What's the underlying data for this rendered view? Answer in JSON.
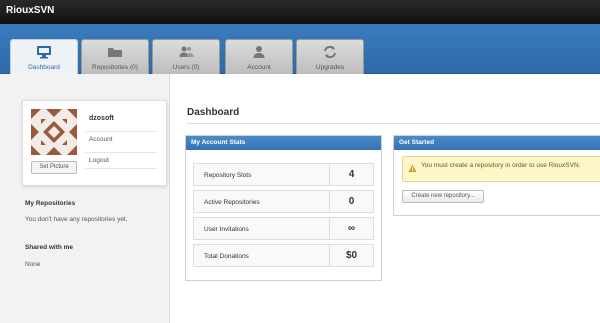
{
  "app": {
    "title": "RiouxSVN"
  },
  "tabs": [
    {
      "label": "Dashboard",
      "icon": "monitor-icon",
      "active": true
    },
    {
      "label": "Repositories (0)",
      "icon": "folder-icon",
      "active": false
    },
    {
      "label": "Users (0)",
      "icon": "users-icon",
      "active": false
    },
    {
      "label": "Account",
      "icon": "user-icon",
      "active": false
    },
    {
      "label": "Upgrades",
      "icon": "refresh-icon",
      "active": false
    }
  ],
  "profile": {
    "username": "dzosoft",
    "set_picture_label": "Set Picture",
    "links": [
      "Account",
      "Logout"
    ]
  },
  "sidebar": {
    "repos_heading": "My Repositories",
    "repos_text": "You don't have any repositories yet.",
    "shared_heading": "Shared with me",
    "shared_text": "None"
  },
  "main": {
    "title": "Dashboard",
    "stats_panel": {
      "title": "My Account Stats",
      "rows": [
        {
          "label": "Repository Slots",
          "value": "4"
        },
        {
          "label": "Active Repositories",
          "value": "0"
        },
        {
          "label": "User Invitations",
          "value": "∞"
        },
        {
          "label": "Total Donations",
          "value": "$0"
        }
      ]
    },
    "started_panel": {
      "title": "Get Started",
      "alert": "You must create a repository in order to use RiouxSVN.",
      "button": "Create new repository..."
    }
  },
  "colors": {
    "accent": "#3574b3",
    "alert_bg": "#fcf6c8",
    "topbar": "#1a1a1a"
  }
}
